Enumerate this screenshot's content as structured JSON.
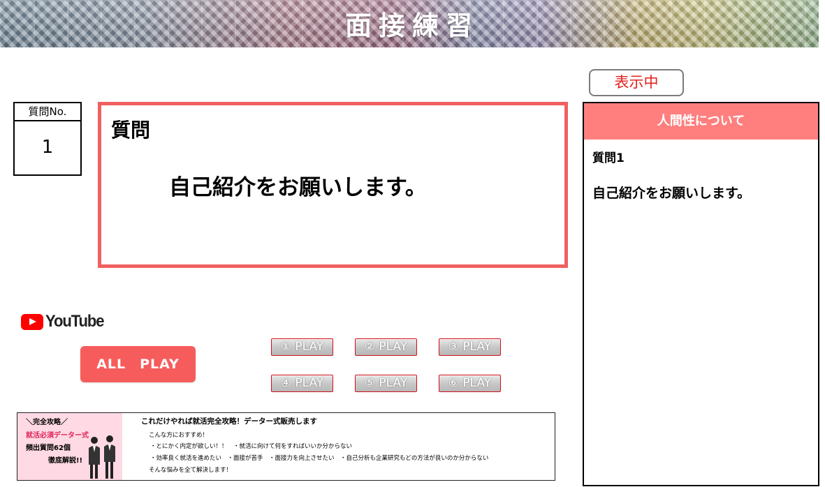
{
  "header": {
    "title": "面接練習"
  },
  "question_number": {
    "label": "質問No.",
    "value": "1"
  },
  "question": {
    "heading": "質問",
    "text": "自己紹介をお願いします。"
  },
  "status_badge": "表示中",
  "side_panel": {
    "category": "人間性について",
    "question_number": "質問1",
    "question_text": "自己紹介をお願いします。"
  },
  "youtube": {
    "logo_text": "YouTube",
    "icon": "youtube-play-icon"
  },
  "buttons": {
    "all_play": "ALL　PLAY",
    "play": [
      "① PLAY",
      "② PLAY",
      "③ PLAY",
      "④ PLAY",
      "⑤ PLAY",
      "⑥ PLAY"
    ]
  },
  "ad": {
    "kicker": "＼完全攻略／",
    "product": "就活必須データー式",
    "count": "頻出質問62個",
    "explain": "徹底解説!!",
    "title": "これだけやれば就活完全攻略！データー式販売します",
    "lines": [
      "こんな方におすすめ！",
      "・とにかく内定が欲しい！！　・就活に向けて何をすればいいか分からない",
      "・効率良く就活を進めたい　・面接が苦手　・面接力を向上させたい　・自己分析も企業研究もどの方法が良いのか分からない",
      "そんな悩みを全て解決します！"
    ]
  },
  "colors": {
    "accent_red": "#f06060",
    "side_header": "#ff7f7f",
    "status_text": "#e0201c",
    "ad_pink": "#ffd9e3"
  }
}
